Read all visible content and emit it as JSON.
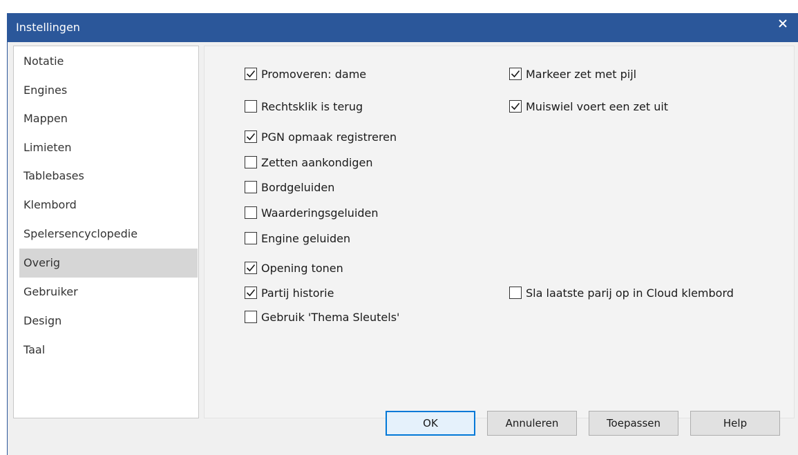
{
  "window": {
    "title": "Instellingen"
  },
  "sidebar": {
    "items": [
      {
        "label": "Notatie",
        "selected": false
      },
      {
        "label": "Engines",
        "selected": false
      },
      {
        "label": "Mappen",
        "selected": false
      },
      {
        "label": "Limieten",
        "selected": false
      },
      {
        "label": "Tablebases",
        "selected": false
      },
      {
        "label": "Klembord",
        "selected": false
      },
      {
        "label": "Spelersencyclopedie",
        "selected": false
      },
      {
        "label": "Overig",
        "selected": true
      },
      {
        "label": "Gebruiker",
        "selected": false
      },
      {
        "label": "Design",
        "selected": false
      },
      {
        "label": "Taal",
        "selected": false
      }
    ]
  },
  "options": {
    "promoveren": {
      "label": "Promoveren: dame",
      "checked": true
    },
    "markeer": {
      "label": "Markeer zet met pijl",
      "checked": true
    },
    "rechtsklik": {
      "label": "Rechtsklik is terug",
      "checked": false
    },
    "muiswiel": {
      "label": "Muiswiel voert een zet uit",
      "checked": true
    },
    "pgn": {
      "label": "PGN opmaak registreren",
      "checked": true
    },
    "zetten": {
      "label": "Zetten aankondigen",
      "checked": false
    },
    "bord": {
      "label": "Bordgeluiden",
      "checked": false
    },
    "waardering": {
      "label": "Waarderingsgeluiden",
      "checked": false
    },
    "engine": {
      "label": "Engine geluiden",
      "checked": false
    },
    "opening": {
      "label": "Opening tonen",
      "checked": true
    },
    "partij": {
      "label": "Partij historie",
      "checked": true
    },
    "cloud": {
      "label": "Sla laatste parij op in Cloud klembord",
      "checked": false
    },
    "thema": {
      "label": "Gebruik 'Thema Sleutels'",
      "checked": false
    }
  },
  "buttons": {
    "ok": "OK",
    "cancel": "Annuleren",
    "apply": "Toepassen",
    "help": "Help"
  },
  "colors": {
    "titlebar": "#2b579a",
    "selected": "#d6d6d6",
    "default_button_border": "#0078d7"
  }
}
